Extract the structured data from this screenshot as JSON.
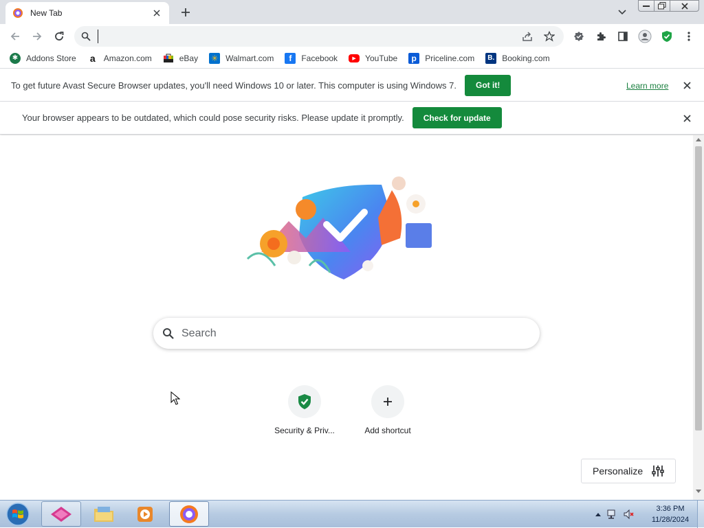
{
  "browser": {
    "tab": {
      "title": "New Tab"
    },
    "omnibox": {
      "value": "",
      "placeholder": ""
    },
    "bookmarks": [
      {
        "label": "Addons Store",
        "icon": "addons-store-icon"
      },
      {
        "label": "Amazon.com",
        "icon": "amazon-icon"
      },
      {
        "label": "eBay",
        "icon": "ebay-icon"
      },
      {
        "label": "Walmart.com",
        "icon": "walmart-icon"
      },
      {
        "label": "Facebook",
        "icon": "facebook-icon"
      },
      {
        "label": "YouTube",
        "icon": "youtube-icon"
      },
      {
        "label": "Priceline.com",
        "icon": "priceline-icon"
      },
      {
        "label": "Booking.com",
        "icon": "booking-icon"
      }
    ]
  },
  "infobars": {
    "windows7": {
      "message": "To get future Avast Secure Browser updates, you'll need Windows 10 or later. This computer is using Windows 7.",
      "button": "Got it!",
      "link": "Learn more"
    },
    "outdated": {
      "message": "Your browser appears to be outdated, which could pose security risks. Please update it promptly.",
      "button": "Check for update"
    }
  },
  "newtab": {
    "search_placeholder": "Search",
    "shortcuts": [
      {
        "label": "Security & Priv...",
        "icon": "shield-check-icon"
      },
      {
        "label": "Add shortcut",
        "icon": "plus-icon"
      }
    ],
    "personalize_label": "Personalize"
  },
  "taskbar": {
    "clock_time": "3:36 PM",
    "clock_date": "11/28/2024"
  },
  "colors": {
    "accent_green": "#148a3c",
    "tab_strip": "#dee1e6",
    "omnibox_bg": "#f1f3f4"
  }
}
